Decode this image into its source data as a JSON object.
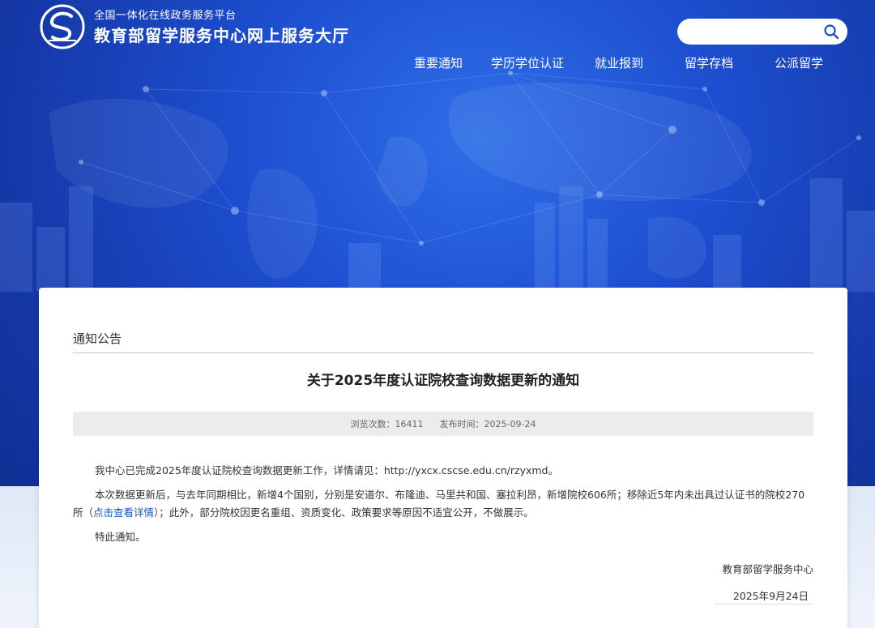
{
  "header": {
    "platform_subtitle": "全国一体化在线政务服务平台",
    "site_title": "教育部留学服务中心网上服务大厅"
  },
  "search": {
    "placeholder": ""
  },
  "nav": {
    "items": [
      {
        "label": "重要通知"
      },
      {
        "label": "学历学位认证"
      },
      {
        "label": "就业报到"
      },
      {
        "label": "留学存档"
      },
      {
        "label": "公派留学"
      }
    ]
  },
  "article": {
    "section": "通知公告",
    "title": "关于2025年度认证院校查询数据更新的通知",
    "views_label": "浏览次数：",
    "views": "16411",
    "published_label": "发布时间：",
    "published": "2025-09-24",
    "p1": "我中心已完成2025年度认证院校查询数据更新工作，详情请见：http://yxcx.cscse.edu.cn/rzyxmd。",
    "p2_before": "本次数据更新后，与去年同期相比，新增4个国别，分别是安道尔、布隆迪、马里共和国、塞拉利昂，新增院校606所；移除近5年内未出具过认证书的院校270所（",
    "p2_link": "点击查看详情",
    "p2_after": "）；此外，部分院校因更名重组、资质变化、政策要求等原因不适宜公开，不做展示。",
    "p3": "特此通知。",
    "signature": "教育部留学服务中心",
    "date": "2025年9月24日"
  },
  "colors": {
    "hero_blue": "#1d4fd0",
    "link_blue": "#1a55c8",
    "meta_bg": "#ececec"
  },
  "icons": {
    "logo": "cscse-logo-icon",
    "search": "search-icon"
  }
}
